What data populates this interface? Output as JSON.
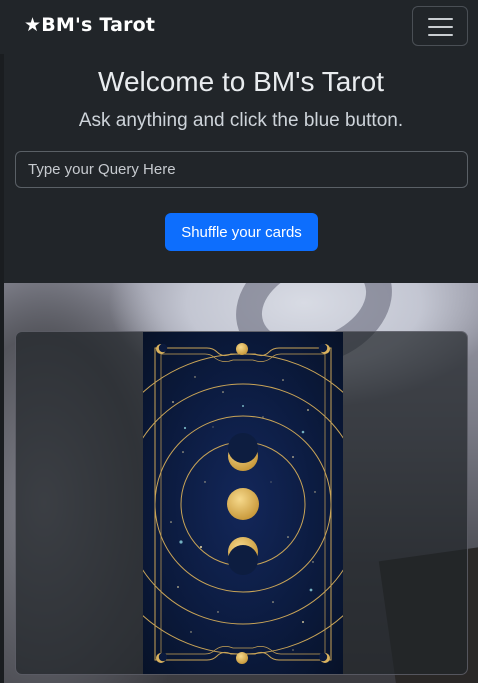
{
  "navbar": {
    "brand": "★BM's Tarot",
    "toggle_icon": "hamburger-menu-icon"
  },
  "hero": {
    "title": "Welcome to BM's Tarot",
    "subtitle": "Ask anything and click the blue button.",
    "query_placeholder": "Type your Query Here",
    "query_value": "",
    "button_label": "Shuffle your cards"
  },
  "card": {
    "image": "tarot-card-back-moon-phases",
    "icon": "moon-phases-icon"
  },
  "colors": {
    "background": "#212529",
    "primary_button": "#0d6efd",
    "card_back": "#0c1b38",
    "gold": "#d9b25e"
  }
}
